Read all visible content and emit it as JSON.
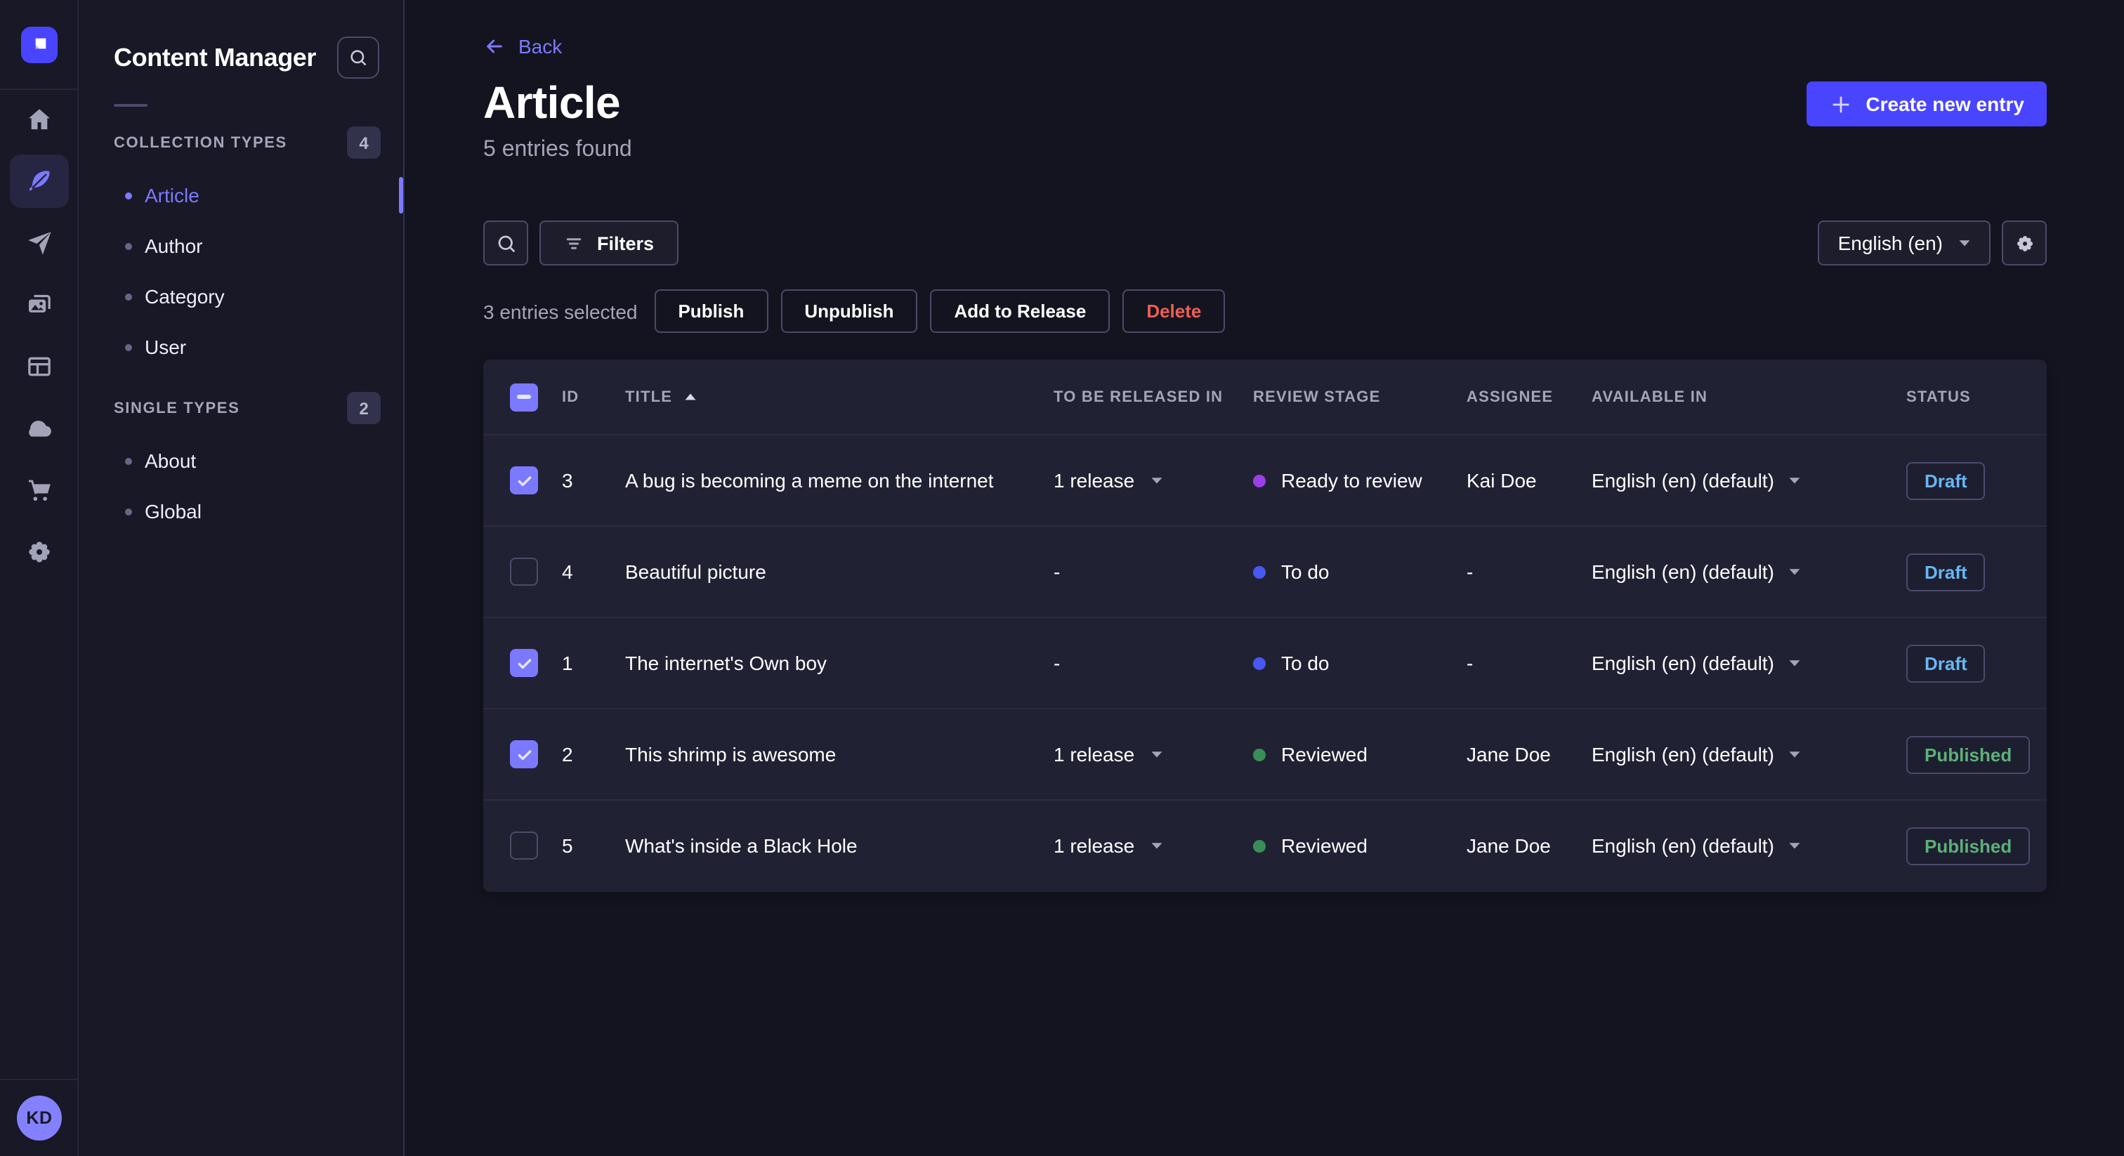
{
  "colors": {
    "accent": "#4945ff",
    "link": "#7b79ff",
    "page_bg": "#141420",
    "panel_bg": "#181826",
    "card_bg": "#212134",
    "border": "#4a4a6a",
    "muted_text": "#a5a5ba",
    "draft_text": "#66b7f1",
    "published_text": "#5cb176",
    "danger_text": "#ee5e52"
  },
  "rail": {
    "logo_icon": "strapi-logo",
    "icons": [
      {
        "name": "home-icon",
        "active": false
      },
      {
        "name": "feather-icon",
        "active": true
      },
      {
        "name": "paper-plane-icon",
        "active": false
      },
      {
        "name": "media-library-icon",
        "active": false
      },
      {
        "name": "layout-icon",
        "active": false
      },
      {
        "name": "cloud-icon",
        "active": false
      },
      {
        "name": "cart-icon",
        "active": false
      },
      {
        "name": "gear-icon",
        "active": false
      }
    ],
    "avatar_initials": "KD"
  },
  "sidebar": {
    "title": "Content Manager",
    "sections": [
      {
        "label": "COLLECTION TYPES",
        "badge": "4",
        "items": [
          {
            "label": "Article",
            "active": true
          },
          {
            "label": "Author",
            "active": false
          },
          {
            "label": "Category",
            "active": false
          },
          {
            "label": "User",
            "active": false
          }
        ]
      },
      {
        "label": "SINGLE TYPES",
        "badge": "2",
        "items": [
          {
            "label": "About",
            "active": false
          },
          {
            "label": "Global",
            "active": false
          }
        ]
      }
    ]
  },
  "header": {
    "back_label": "Back",
    "title": "Article",
    "subtitle": "5 entries found",
    "create_button_label": "Create new entry"
  },
  "toolbar": {
    "filters_label": "Filters",
    "locale_selected": "English (en)"
  },
  "selection": {
    "summary": "3 entries selected",
    "publish_label": "Publish",
    "unpublish_label": "Unpublish",
    "add_to_release_label": "Add to Release",
    "delete_label": "Delete"
  },
  "table": {
    "columns": {
      "id": "ID",
      "title": "TITLE",
      "to_be_released_in": "TO BE RELEASED IN",
      "review_stage": "REVIEW STAGE",
      "assignee": "ASSIGNEE",
      "available_in": "AVAILABLE IN",
      "status": "STATUS"
    },
    "sort": {
      "column": "TITLE",
      "direction": "asc"
    },
    "header_checkbox": "indeterminate",
    "rows": [
      {
        "checkbox": "checked",
        "id": "3",
        "title": "A bug is becoming a meme on the internet",
        "release": "1 release",
        "stage": "Ready to review",
        "stage_color": "#9b3fe8",
        "assignee": "Kai Doe",
        "locale": "English (en) (default)",
        "status": "Draft",
        "status_color": "#66b7f1"
      },
      {
        "checkbox": "unchecked",
        "id": "4",
        "title": "Beautiful picture",
        "release": "-",
        "stage": "To do",
        "stage_color": "#4858f2",
        "assignee": "-",
        "locale": "English (en) (default)",
        "status": "Draft",
        "status_color": "#66b7f1"
      },
      {
        "checkbox": "checked",
        "id": "1",
        "title": "The internet's Own boy",
        "release": "-",
        "stage": "To do",
        "stage_color": "#4858f2",
        "assignee": "-",
        "locale": "English (en) (default)",
        "status": "Draft",
        "status_color": "#66b7f1"
      },
      {
        "checkbox": "checked",
        "id": "2",
        "title": "This shrimp is awesome",
        "release": "1 release",
        "stage": "Reviewed",
        "stage_color": "#388e55",
        "assignee": "Jane Doe",
        "locale": "English (en) (default)",
        "status": "Published",
        "status_color": "#5cb176"
      },
      {
        "checkbox": "unchecked",
        "id": "5",
        "title": "What's inside a Black Hole",
        "release": "1 release",
        "stage": "Reviewed",
        "stage_color": "#388e55",
        "assignee": "Jane Doe",
        "locale": "English (en) (default)",
        "status": "Published",
        "status_color": "#5cb176"
      }
    ]
  },
  "help": {
    "label": "?"
  }
}
